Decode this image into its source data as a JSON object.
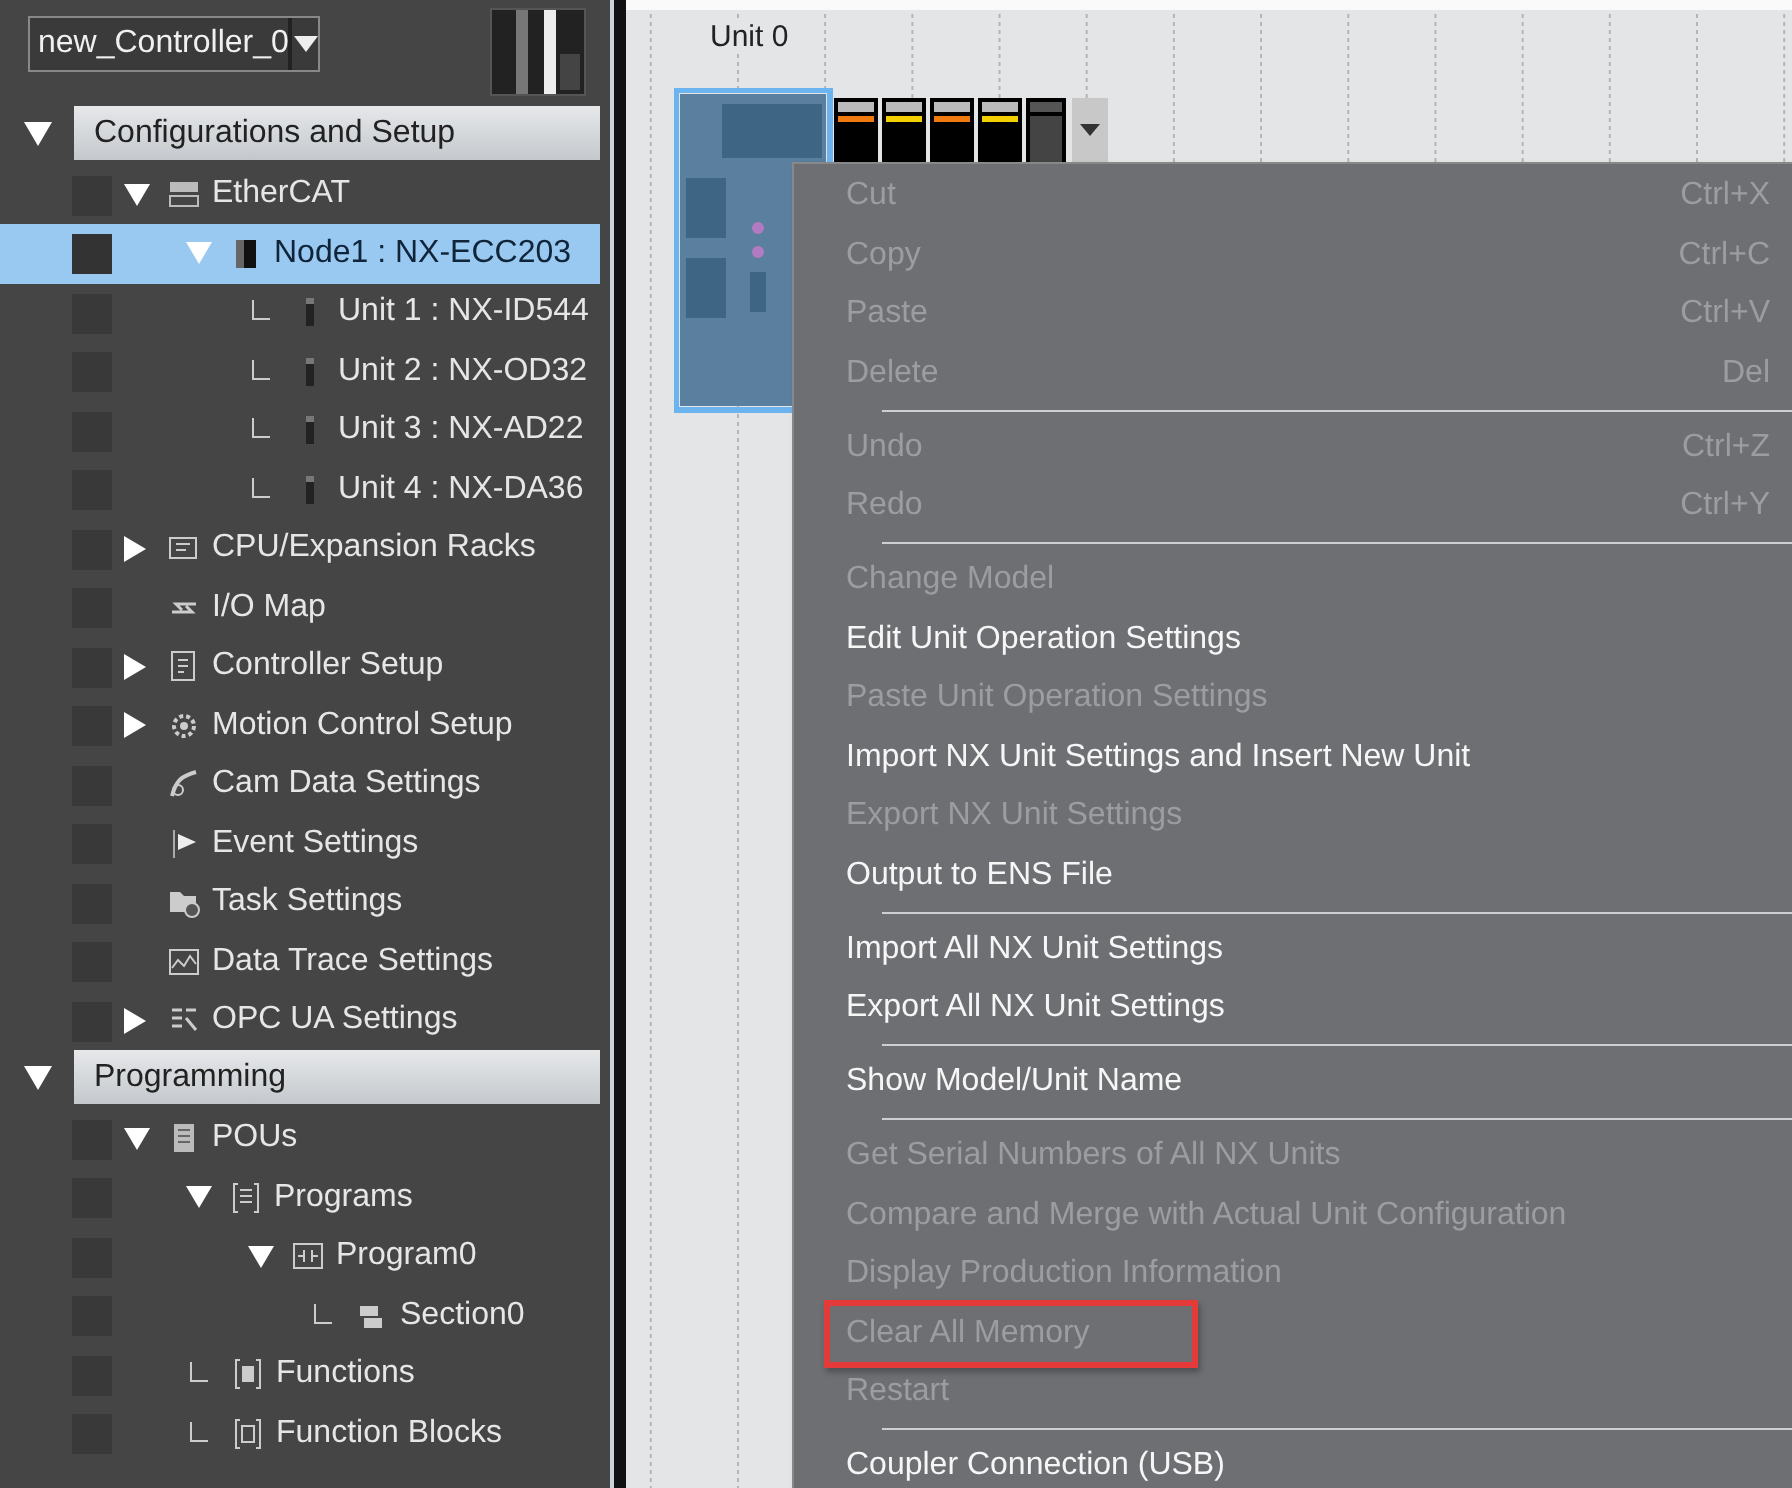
{
  "controller_selector": {
    "value": "new_Controller_0"
  },
  "sidebar": {
    "sections": [
      {
        "label": "Configurations and Setup",
        "expanded": true,
        "items": [
          {
            "label": "EtherCAT",
            "kind": "ethercat",
            "selected": false,
            "expanded": true,
            "children": [
              {
                "label": "Node1 : NX-ECC203",
                "kind": "coupler",
                "selected": true,
                "expanded": true,
                "children": [
                  {
                    "label": "Unit 1 : NX-ID544",
                    "kind": "unit",
                    "selected": false
                  },
                  {
                    "label": "Unit 2 : NX-OD32",
                    "kind": "unit",
                    "selected": false
                  },
                  {
                    "label": "Unit 3 : NX-AD22",
                    "kind": "unit",
                    "selected": false
                  },
                  {
                    "label": "Unit 4 : NX-DA36",
                    "kind": "unit",
                    "selected": false
                  }
                ]
              }
            ]
          },
          {
            "label": "CPU/Expansion Racks",
            "kind": "rack",
            "selected": false,
            "expanded": false
          },
          {
            "label": "I/O Map",
            "kind": "iomap",
            "selected": false
          },
          {
            "label": "Controller Setup",
            "kind": "controller",
            "selected": false,
            "expanded": false
          },
          {
            "label": "Motion Control Setup",
            "kind": "motion",
            "selected": false,
            "expanded": false
          },
          {
            "label": "Cam Data Settings",
            "kind": "cam",
            "selected": false
          },
          {
            "label": "Event Settings",
            "kind": "event",
            "selected": false
          },
          {
            "label": "Task Settings",
            "kind": "task",
            "selected": false
          },
          {
            "label": "Data Trace Settings",
            "kind": "trace",
            "selected": false
          },
          {
            "label": "OPC UA Settings",
            "kind": "opc",
            "selected": false,
            "expanded": false
          }
        ]
      },
      {
        "label": "Programming",
        "expanded": true,
        "items": [
          {
            "label": "POUs",
            "kind": "pou",
            "selected": false,
            "expanded": true,
            "children": [
              {
                "label": "Programs",
                "kind": "programs",
                "selected": false,
                "expanded": true,
                "children": [
                  {
                    "label": "Program0",
                    "kind": "program",
                    "selected": false,
                    "expanded": true,
                    "children": [
                      {
                        "label": "Section0",
                        "kind": "section",
                        "selected": false
                      }
                    ]
                  }
                ]
              },
              {
                "label": "Functions",
                "kind": "functions",
                "selected": false
              },
              {
                "label": "Function Blocks",
                "kind": "fblocks",
                "selected": false
              }
            ]
          }
        ]
      }
    ]
  },
  "canvas": {
    "unit_label": "Unit 0",
    "device": {
      "selected": true
    }
  },
  "context_menu": {
    "items": [
      {
        "kind": "item",
        "label": "Cut",
        "shortcut": "Ctrl+X",
        "disabled": true,
        "highlighted": false
      },
      {
        "kind": "item",
        "label": "Copy",
        "shortcut": "Ctrl+C",
        "disabled": true,
        "highlighted": false
      },
      {
        "kind": "item",
        "label": "Paste",
        "shortcut": "Ctrl+V",
        "disabled": true,
        "highlighted": false
      },
      {
        "kind": "item",
        "label": "Delete",
        "shortcut": "Del",
        "disabled": true,
        "highlighted": false
      },
      {
        "kind": "separator"
      },
      {
        "kind": "item",
        "label": "Undo",
        "shortcut": "Ctrl+Z",
        "disabled": true,
        "highlighted": false
      },
      {
        "kind": "item",
        "label": "Redo",
        "shortcut": "Ctrl+Y",
        "disabled": true,
        "highlighted": false
      },
      {
        "kind": "separator"
      },
      {
        "kind": "item",
        "label": "Change Model",
        "disabled": true,
        "highlighted": false
      },
      {
        "kind": "item",
        "label": "Edit Unit Operation Settings",
        "disabled": false,
        "highlighted": false
      },
      {
        "kind": "item",
        "label": "Paste Unit Operation Settings",
        "disabled": true,
        "highlighted": false
      },
      {
        "kind": "item",
        "label": "Import NX Unit Settings and Insert New Unit",
        "disabled": false,
        "highlighted": false
      },
      {
        "kind": "item",
        "label": "Export NX Unit Settings",
        "disabled": true,
        "highlighted": false
      },
      {
        "kind": "item",
        "label": "Output to ENS File",
        "disabled": false,
        "highlighted": false
      },
      {
        "kind": "separator"
      },
      {
        "kind": "item",
        "label": "Import All NX Unit Settings",
        "disabled": false,
        "highlighted": false
      },
      {
        "kind": "item",
        "label": "Export All NX Unit Settings",
        "disabled": false,
        "highlighted": false
      },
      {
        "kind": "separator"
      },
      {
        "kind": "item",
        "label": "Show Model/Unit Name",
        "disabled": false,
        "highlighted": false
      },
      {
        "kind": "separator"
      },
      {
        "kind": "item",
        "label": "Get Serial Numbers of All NX Units",
        "disabled": true,
        "highlighted": false
      },
      {
        "kind": "item",
        "label": "Compare and Merge with Actual Unit Configuration",
        "disabled": true,
        "highlighted": false
      },
      {
        "kind": "item",
        "label": "Display Production Information",
        "disabled": true,
        "highlighted": false
      },
      {
        "kind": "item",
        "label": "Clear All Memory",
        "disabled": true,
        "highlighted": true
      },
      {
        "kind": "item",
        "label": "Restart",
        "disabled": true,
        "highlighted": false
      },
      {
        "kind": "separator"
      },
      {
        "kind": "item",
        "label": "Coupler Connection (USB)",
        "disabled": false,
        "highlighted": false
      }
    ]
  }
}
